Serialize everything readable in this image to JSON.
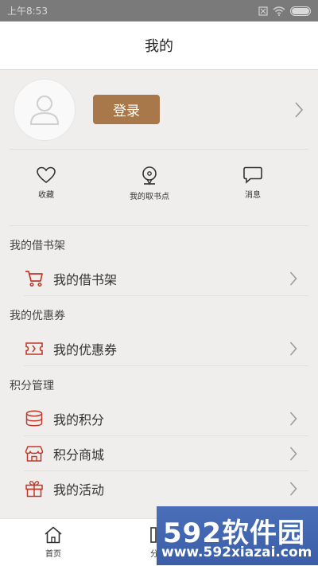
{
  "status_bar": {
    "time": "上午8:53"
  },
  "header": {
    "title": "我的"
  },
  "profile": {
    "login_label": "登录"
  },
  "quick_actions": [
    {
      "label": "收藏",
      "icon": "heart-icon"
    },
    {
      "label": "我的取书点",
      "icon": "location-pin-icon"
    },
    {
      "label": "消息",
      "icon": "message-icon"
    }
  ],
  "sections": [
    {
      "title": "我的借书架",
      "rows": [
        {
          "label": "我的借书架",
          "icon": "cart-icon"
        }
      ]
    },
    {
      "title": "我的优惠券",
      "rows": [
        {
          "label": "我的优惠券",
          "icon": "ticket-icon"
        }
      ]
    },
    {
      "title": "积分管理",
      "rows": [
        {
          "label": "我的积分",
          "icon": "coins-icon"
        },
        {
          "label": "积分商城",
          "icon": "shop-icon"
        },
        {
          "label": "我的活动",
          "icon": "gift-icon"
        }
      ]
    }
  ],
  "tab_bar": [
    {
      "label": "首页",
      "icon": "home-icon"
    },
    {
      "label": "分类",
      "icon": "category-icon"
    }
  ],
  "watermark": {
    "brand": "592软件园",
    "url": "www.592xiazai.com"
  },
  "colors": {
    "accent": "#a8784a",
    "icon_red": "#c0392b",
    "background": "#efeeec"
  }
}
